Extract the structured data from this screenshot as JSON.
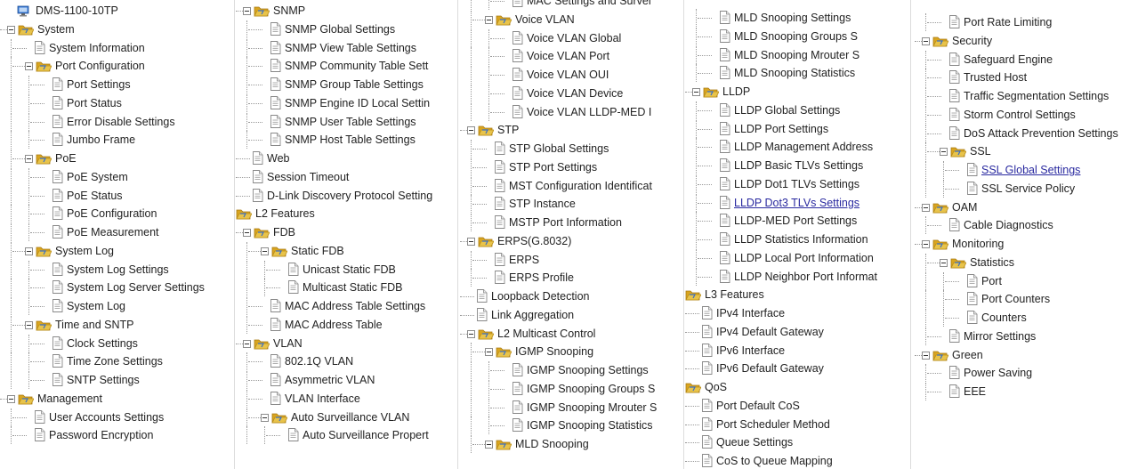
{
  "colors": {
    "link": "#2a2aa0",
    "folder": "#e8c34a",
    "device": "#3a7bd5"
  },
  "columns": [
    {
      "nodes": [
        {
          "l": 0,
          "t": "device",
          "label": "DMS-1100-10TP"
        },
        {
          "l": 0,
          "t": "folder",
          "label": "System"
        },
        {
          "l": 1,
          "t": "page",
          "label": "System Information"
        },
        {
          "l": 1,
          "t": "folder",
          "label": "Port Configuration"
        },
        {
          "l": 2,
          "t": "page",
          "label": "Port Settings"
        },
        {
          "l": 2,
          "t": "page",
          "label": "Port Status"
        },
        {
          "l": 2,
          "t": "page",
          "label": "Error Disable Settings"
        },
        {
          "l": 2,
          "t": "page",
          "label": "Jumbo Frame"
        },
        {
          "l": 1,
          "t": "folder",
          "label": "PoE"
        },
        {
          "l": 2,
          "t": "page",
          "label": "PoE System"
        },
        {
          "l": 2,
          "t": "page",
          "label": "PoE Status"
        },
        {
          "l": 2,
          "t": "page",
          "label": "PoE Configuration"
        },
        {
          "l": 2,
          "t": "page",
          "label": "PoE Measurement"
        },
        {
          "l": 1,
          "t": "folder",
          "label": "System Log"
        },
        {
          "l": 2,
          "t": "page",
          "label": "System Log Settings"
        },
        {
          "l": 2,
          "t": "page",
          "label": "System Log Server Settings"
        },
        {
          "l": 2,
          "t": "page",
          "label": "System Log"
        },
        {
          "l": 1,
          "t": "folder",
          "label": "Time and SNTP"
        },
        {
          "l": 2,
          "t": "page",
          "label": "Clock Settings"
        },
        {
          "l": 2,
          "t": "page",
          "label": "Time Zone Settings"
        },
        {
          "l": 2,
          "t": "page",
          "label": "SNTP Settings"
        },
        {
          "l": 0,
          "t": "folder",
          "label": "Management"
        },
        {
          "l": 1,
          "t": "page",
          "label": "User Accounts Settings"
        },
        {
          "l": 1,
          "t": "page",
          "label": "Password Encryption"
        }
      ]
    },
    {
      "nodes": [
        {
          "l": 0,
          "t": "folder",
          "label": "SNMP"
        },
        {
          "l": 1,
          "t": "page",
          "label": "SNMP Global Settings"
        },
        {
          "l": 1,
          "t": "page",
          "label": "SNMP View Table Settings"
        },
        {
          "l": 1,
          "t": "page",
          "label": "SNMP Community Table Sett"
        },
        {
          "l": 1,
          "t": "page",
          "label": "SNMP Group Table Settings"
        },
        {
          "l": 1,
          "t": "page",
          "label": "SNMP Engine ID Local Settin"
        },
        {
          "l": 1,
          "t": "page",
          "label": "SNMP User Table Settings"
        },
        {
          "l": 1,
          "t": "page",
          "label": "SNMP Host Table Settings"
        },
        {
          "l": 0,
          "t": "page",
          "label": "Web"
        },
        {
          "l": 0,
          "t": "page",
          "label": "Session Timeout"
        },
        {
          "l": 0,
          "t": "page",
          "label": "D-Link Discovery Protocol Setting"
        },
        {
          "l": -1,
          "t": "folder",
          "label": "L2 Features"
        },
        {
          "l": 0,
          "t": "folder",
          "label": "FDB"
        },
        {
          "l": 1,
          "t": "folder",
          "label": "Static FDB"
        },
        {
          "l": 2,
          "t": "page",
          "label": "Unicast Static FDB"
        },
        {
          "l": 2,
          "t": "page",
          "label": "Multicast Static FDB"
        },
        {
          "l": 1,
          "t": "page",
          "label": "MAC Address Table Settings"
        },
        {
          "l": 1,
          "t": "page",
          "label": "MAC Address Table"
        },
        {
          "l": 0,
          "t": "folder",
          "label": "VLAN"
        },
        {
          "l": 1,
          "t": "page",
          "label": "802.1Q VLAN"
        },
        {
          "l": 1,
          "t": "page",
          "label": "Asymmetric VLAN"
        },
        {
          "l": 1,
          "t": "page",
          "label": "VLAN Interface"
        },
        {
          "l": 1,
          "t": "folder",
          "label": "Auto Surveillance VLAN"
        },
        {
          "l": 2,
          "t": "page",
          "label": "Auto Surveillance Propert"
        }
      ]
    },
    {
      "nodes": [
        {
          "l": 2,
          "t": "page",
          "label": "MAC Settings and Survei"
        },
        {
          "l": 1,
          "t": "folder",
          "label": "Voice VLAN"
        },
        {
          "l": 2,
          "t": "page",
          "label": "Voice VLAN Global"
        },
        {
          "l": 2,
          "t": "page",
          "label": "Voice VLAN Port"
        },
        {
          "l": 2,
          "t": "page",
          "label": "Voice VLAN OUI"
        },
        {
          "l": 2,
          "t": "page",
          "label": "Voice VLAN Device"
        },
        {
          "l": 2,
          "t": "page",
          "label": "Voice VLAN LLDP-MED I"
        },
        {
          "l": 0,
          "t": "folder",
          "label": "STP"
        },
        {
          "l": 1,
          "t": "page",
          "label": "STP Global Settings"
        },
        {
          "l": 1,
          "t": "page",
          "label": "STP Port Settings"
        },
        {
          "l": 1,
          "t": "page",
          "label": "MST Configuration Identificat"
        },
        {
          "l": 1,
          "t": "page",
          "label": "STP Instance"
        },
        {
          "l": 1,
          "t": "page",
          "label": "MSTP Port Information"
        },
        {
          "l": 0,
          "t": "folder",
          "label": "ERPS(G.8032)"
        },
        {
          "l": 1,
          "t": "page",
          "label": "ERPS"
        },
        {
          "l": 1,
          "t": "page",
          "label": "ERPS Profile"
        },
        {
          "l": 0,
          "t": "page",
          "label": "Loopback Detection"
        },
        {
          "l": 0,
          "t": "page",
          "label": "Link Aggregation"
        },
        {
          "l": 0,
          "t": "folder",
          "label": "L2 Multicast Control"
        },
        {
          "l": 1,
          "t": "folder",
          "label": "IGMP Snooping"
        },
        {
          "l": 2,
          "t": "page",
          "label": "IGMP Snooping Settings"
        },
        {
          "l": 2,
          "t": "page",
          "label": "IGMP Snooping Groups S"
        },
        {
          "l": 2,
          "t": "page",
          "label": "IGMP Snooping Mrouter S"
        },
        {
          "l": 2,
          "t": "page",
          "label": "IGMP Snooping Statistics"
        },
        {
          "l": 1,
          "t": "folder",
          "label": "MLD Snooping"
        }
      ]
    },
    {
      "nodes": [
        {
          "l": 1,
          "t": "page",
          "label": "MLD Snooping Settings"
        },
        {
          "l": 1,
          "t": "page",
          "label": "MLD Snooping Groups S"
        },
        {
          "l": 1,
          "t": "page",
          "label": "MLD Snooping Mrouter S"
        },
        {
          "l": 1,
          "t": "page",
          "label": "MLD Snooping Statistics"
        },
        {
          "l": 0,
          "t": "folder",
          "label": "LLDP"
        },
        {
          "l": 1,
          "t": "page",
          "label": "LLDP Global Settings"
        },
        {
          "l": 1,
          "t": "page",
          "label": "LLDP Port Settings"
        },
        {
          "l": 1,
          "t": "page",
          "label": "LLDP Management Address"
        },
        {
          "l": 1,
          "t": "page",
          "label": "LLDP Basic TLVs Settings"
        },
        {
          "l": 1,
          "t": "page",
          "label": "LLDP Dot1 TLVs Settings"
        },
        {
          "l": 1,
          "t": "page",
          "label": "LLDP Dot3 TLVs Settings",
          "link": true
        },
        {
          "l": 1,
          "t": "page",
          "label": "LLDP-MED Port Settings"
        },
        {
          "l": 1,
          "t": "page",
          "label": "LLDP Statistics Information"
        },
        {
          "l": 1,
          "t": "page",
          "label": "LLDP Local Port Information"
        },
        {
          "l": 1,
          "t": "page",
          "label": "LLDP Neighbor Port Informat"
        },
        {
          "l": -1,
          "t": "folder",
          "label": "L3 Features"
        },
        {
          "l": 0,
          "t": "page",
          "label": "IPv4 Interface"
        },
        {
          "l": 0,
          "t": "page",
          "label": "IPv4 Default Gateway"
        },
        {
          "l": 0,
          "t": "page",
          "label": "IPv6 Interface"
        },
        {
          "l": 0,
          "t": "page",
          "label": "IPv6 Default Gateway"
        },
        {
          "l": -1,
          "t": "folder",
          "label": "QoS"
        },
        {
          "l": 0,
          "t": "page",
          "label": "Port Default CoS"
        },
        {
          "l": 0,
          "t": "page",
          "label": "Port Scheduler Method"
        },
        {
          "l": 0,
          "t": "page",
          "label": "Queue Settings"
        },
        {
          "l": 0,
          "t": "page",
          "label": "CoS to Queue Mapping"
        }
      ]
    },
    {
      "nodes": [
        {
          "l": 1,
          "t": "page",
          "label": "Port Rate Limiting"
        },
        {
          "l": 0,
          "t": "folder",
          "label": "Security"
        },
        {
          "l": 1,
          "t": "page",
          "label": "Safeguard Engine"
        },
        {
          "l": 1,
          "t": "page",
          "label": "Trusted Host"
        },
        {
          "l": 1,
          "t": "page",
          "label": "Traffic Segmentation Settings"
        },
        {
          "l": 1,
          "t": "page",
          "label": "Storm Control Settings"
        },
        {
          "l": 1,
          "t": "page",
          "label": "DoS Attack Prevention Settings"
        },
        {
          "l": 1,
          "t": "folder",
          "label": "SSL"
        },
        {
          "l": 2,
          "t": "page",
          "label": "SSL Global Settings",
          "link": true
        },
        {
          "l": 2,
          "t": "page",
          "label": "SSL Service Policy"
        },
        {
          "l": 0,
          "t": "folder",
          "label": "OAM"
        },
        {
          "l": 1,
          "t": "page",
          "label": "Cable Diagnostics"
        },
        {
          "l": 0,
          "t": "folder",
          "label": "Monitoring"
        },
        {
          "l": 1,
          "t": "folder",
          "label": "Statistics"
        },
        {
          "l": 2,
          "t": "page",
          "label": "Port"
        },
        {
          "l": 2,
          "t": "page",
          "label": "Port Counters"
        },
        {
          "l": 2,
          "t": "page",
          "label": "Counters"
        },
        {
          "l": 1,
          "t": "page",
          "label": "Mirror Settings"
        },
        {
          "l": 0,
          "t": "folder",
          "label": "Green"
        },
        {
          "l": 1,
          "t": "page",
          "label": "Power Saving"
        },
        {
          "l": 1,
          "t": "page",
          "label": "EEE"
        }
      ]
    }
  ]
}
